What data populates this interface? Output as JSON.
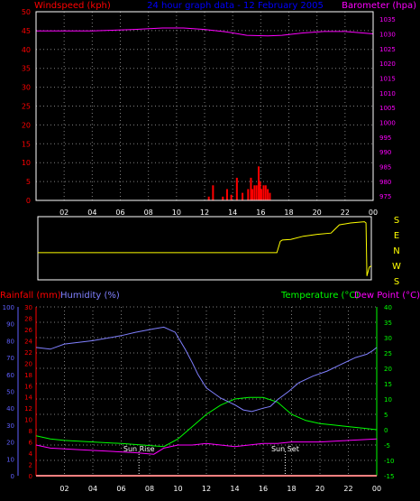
{
  "colors": {
    "background": "#000000",
    "frame": "#ffffff",
    "grid": "#808080",
    "windspeed": "#ff0000",
    "barometer": "#ff00ff",
    "title": "#0000ff",
    "direction": "#ffff00",
    "rainfall": "#ff0000",
    "humidity": "#8080ff",
    "temperature": "#00ff00",
    "dewpoint": "#ff00ff",
    "rain_axis": "#ff0000",
    "hum_axis": "#6060ff",
    "temp_axis": "#00ff00",
    "x_ticks": "#ffffff",
    "direction_letters": "#ffff00"
  },
  "chart_data": [
    {
      "type": "line",
      "title": "24 hour graph data - 12 February 2005",
      "ylabel_left": "Windspeed (kph)",
      "ylabel_right": "Barometer (hpa)",
      "x_hours": [
        0,
        24
      ],
      "x_ticks": [
        "02",
        "04",
        "06",
        "08",
        "10",
        "12",
        "14",
        "16",
        "18",
        "20",
        "22",
        "00"
      ],
      "y_left_ticks": [
        "0",
        "5",
        "10",
        "15",
        "20",
        "25",
        "30",
        "35",
        "40",
        "45",
        "50"
      ],
      "y_left_range": [
        0,
        50
      ],
      "y_right_ticks": [
        "975",
        "980",
        "985",
        "990",
        "995",
        "1000",
        "1005",
        "1010",
        "1015",
        "1020",
        "1025",
        "1030",
        "1035"
      ],
      "y_right_range": [
        973.5,
        1037.5
      ],
      "grid": true,
      "series": [
        {
          "name": "Windspeed",
          "axis": "left",
          "style": "bars",
          "points": [
            [
              12.3,
              1
            ],
            [
              12.6,
              4
            ],
            [
              13.3,
              1
            ],
            [
              13.6,
              3
            ],
            [
              13.9,
              1.5
            ],
            [
              14.3,
              6
            ],
            [
              14.7,
              2
            ],
            [
              15.1,
              3
            ],
            [
              15.3,
              6
            ],
            [
              15.4,
              3
            ],
            [
              15.55,
              4
            ],
            [
              15.7,
              4
            ],
            [
              15.85,
              9
            ],
            [
              15.95,
              5
            ],
            [
              16.05,
              3
            ],
            [
              16.2,
              4
            ],
            [
              16.35,
              4
            ],
            [
              16.5,
              3
            ],
            [
              16.65,
              2
            ]
          ]
        },
        {
          "name": "Barometer",
          "axis": "right",
          "points": [
            [
              0,
              1031
            ],
            [
              4,
              1031
            ],
            [
              7,
              1031.5
            ],
            [
              9,
              1032
            ],
            [
              10.5,
              1032
            ],
            [
              12,
              1031.5
            ],
            [
              13.5,
              1030.7
            ],
            [
              15,
              1029.5
            ],
            [
              16.5,
              1029.3
            ],
            [
              17.5,
              1029.5
            ],
            [
              19,
              1030.3
            ],
            [
              20.5,
              1030.8
            ],
            [
              22,
              1030.8
            ],
            [
              24,
              1030
            ]
          ]
        }
      ]
    },
    {
      "type": "line",
      "name": "Wind direction",
      "y_labels": [
        "S",
        "E",
        "N",
        "W",
        "S"
      ],
      "series": [
        {
          "name": "Direction",
          "style": "step",
          "points": [
            [
              0,
              0.43
            ],
            [
              17.2,
              0.43
            ],
            [
              17.45,
              0.61
            ],
            [
              17.6,
              0.63
            ],
            [
              18.2,
              0.64
            ],
            [
              19.1,
              0.69
            ],
            [
              20.1,
              0.72
            ],
            [
              21.1,
              0.74
            ],
            [
              21.7,
              0.87
            ],
            [
              22.5,
              0.9
            ],
            [
              23.5,
              0.92
            ],
            [
              23.62,
              0.9
            ],
            [
              23.68,
              0.06
            ],
            [
              23.85,
              0.2
            ],
            [
              24,
              0.22
            ]
          ]
        }
      ]
    },
    {
      "type": "line",
      "ylabel_left_1": "Rainfall (mm)",
      "ylabel_left_2": "Humidity (%)",
      "ylabel_right_1": "Temperature (°C)",
      "ylabel_right_2": "Dew Point (°C)",
      "x_hours": [
        0,
        24
      ],
      "x_ticks": [
        "02",
        "04",
        "06",
        "08",
        "10",
        "12",
        "14",
        "16",
        "18",
        "20",
        "22",
        "00"
      ],
      "humidity_ticks": [
        "0",
        "10",
        "20",
        "30",
        "40",
        "50",
        "60",
        "70",
        "80",
        "90",
        "100"
      ],
      "humidity_range": [
        0,
        100
      ],
      "rain_ticks": [
        "0",
        "2",
        "4",
        "6",
        "8",
        "10",
        "12",
        "14",
        "16",
        "18",
        "20",
        "22",
        "24",
        "26",
        "28",
        "30"
      ],
      "rain_range": [
        0,
        30
      ],
      "temp_ticks": [
        "-15",
        "-10",
        "-5",
        "0",
        "5",
        "10",
        "15",
        "20",
        "25",
        "30",
        "35",
        "40"
      ],
      "temp_range": [
        -15,
        40
      ],
      "annotations": [
        {
          "text": "Sun Rise",
          "hour": 7.25
        },
        {
          "text": "Sun Set",
          "hour": 17.55
        }
      ],
      "grid": true,
      "series": [
        {
          "name": "Humidity",
          "axis": "humidity",
          "points": [
            [
              0,
              76
            ],
            [
              1,
              75
            ],
            [
              2,
              78
            ],
            [
              4,
              80
            ],
            [
              6,
              83
            ],
            [
              7,
              85
            ],
            [
              8.3,
              87
            ],
            [
              9,
              88
            ],
            [
              9.8,
              85
            ],
            [
              10.5,
              75
            ],
            [
              11,
              67
            ],
            [
              11.4,
              60
            ],
            [
              12,
              52
            ],
            [
              12.5,
              49
            ],
            [
              13,
              46
            ],
            [
              13.5,
              44
            ],
            [
              14,
              42
            ],
            [
              14.6,
              39
            ],
            [
              15.2,
              38
            ],
            [
              16,
              40
            ],
            [
              16.5,
              41
            ],
            [
              17,
              45
            ],
            [
              17.8,
              50
            ],
            [
              18.5,
              55
            ],
            [
              19.5,
              59
            ],
            [
              20.5,
              62
            ],
            [
              21.5,
              66
            ],
            [
              22.5,
              70
            ],
            [
              23.3,
              72
            ],
            [
              23.7,
              74
            ],
            [
              24,
              76
            ]
          ]
        },
        {
          "name": "Temperature",
          "axis": "temp",
          "points": [
            [
              0,
              -2
            ],
            [
              1,
              -3
            ],
            [
              2,
              -3.5
            ],
            [
              4,
              -4
            ],
            [
              6,
              -4.5
            ],
            [
              7.5,
              -5
            ],
            [
              9,
              -5.5
            ],
            [
              10,
              -3
            ],
            [
              11,
              1
            ],
            [
              12,
              5
            ],
            [
              13,
              8
            ],
            [
              14,
              10
            ],
            [
              15,
              10.5
            ],
            [
              16,
              10.5
            ],
            [
              17,
              9
            ],
            [
              18,
              5
            ],
            [
              19,
              3
            ],
            [
              20,
              2
            ],
            [
              21,
              1.5
            ],
            [
              22,
              1
            ],
            [
              23,
              0.5
            ],
            [
              24,
              0
            ]
          ]
        },
        {
          "name": "Dew Point",
          "axis": "temp",
          "points": [
            [
              0,
              -5
            ],
            [
              1,
              -6
            ],
            [
              3,
              -6.5
            ],
            [
              5,
              -7
            ],
            [
              7,
              -7.5
            ],
            [
              8.3,
              -8
            ],
            [
              9,
              -6
            ],
            [
              10,
              -5
            ],
            [
              11,
              -5
            ],
            [
              12,
              -4.5
            ],
            [
              13,
              -5
            ],
            [
              14,
              -5.5
            ],
            [
              15,
              -5
            ],
            [
              16,
              -4.5
            ],
            [
              17,
              -4.5
            ],
            [
              18,
              -4
            ],
            [
              20,
              -4
            ],
            [
              22,
              -3.5
            ],
            [
              24,
              -3
            ]
          ]
        },
        {
          "name": "Rainfall",
          "axis": "rain",
          "points": [
            [
              0,
              0
            ],
            [
              24,
              0
            ]
          ]
        }
      ]
    }
  ]
}
